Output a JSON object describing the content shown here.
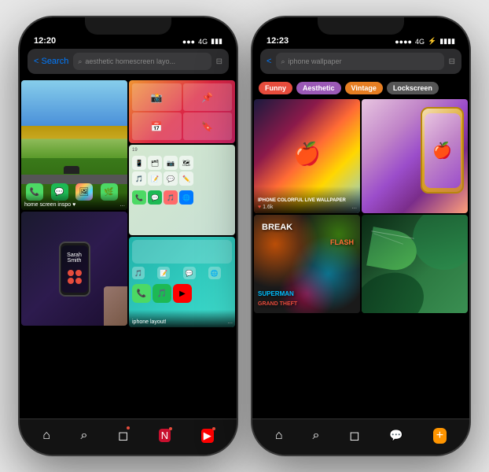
{
  "phone1": {
    "status_time": "12:20",
    "signal": "▲▲▲▲",
    "network": "4G",
    "battery": "■■■",
    "search_back": "< Search",
    "search_placeholder": "aesthetic homescreen layo...",
    "filter_icon": "⊞",
    "card1_label": "home screen inspo ♥",
    "card1_dots": "...",
    "card2_label": "iphone layout!",
    "card2_dots": "...",
    "nav_home": "⌂",
    "nav_search": "⌕",
    "nav_inbox": "⊡",
    "nav_profile": "⊙",
    "nav_plus": "+"
  },
  "phone2": {
    "status_time": "12:23",
    "signal": "▲▲▲▲",
    "network": "4G",
    "battery": "⚡■■■",
    "search_back": "< ",
    "search_placeholder": "iphone wallpaper",
    "filter_icon": "⊞",
    "tag_funny": "Funny",
    "tag_aesthetic": "Aesthetic",
    "tag_vintage": "Vintage",
    "tag_lockscreen": "Lockscreen",
    "card1_title": "IPHONE COLORFUL LIVE\nWALLPAPER",
    "card1_likes": "1.6k",
    "card1_dots": "...",
    "nav_home": "⌂",
    "nav_search": "⌕",
    "nav_inbox": "⊡",
    "nav_profile": "⊙",
    "nav_plus": "+"
  }
}
